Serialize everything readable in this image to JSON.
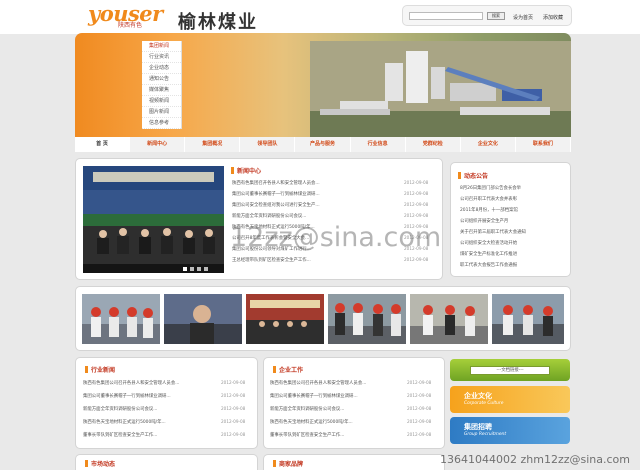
{
  "header": {
    "logo_word": "youser",
    "logo_sub": "陕西有色",
    "brand_title": "榆林煤业",
    "search_button": "搜索",
    "link_home": "设为首页",
    "link_favorite": "添加收藏"
  },
  "banner": {
    "sub_nav": [
      "集团新闻",
      "行业资讯",
      "企业动态",
      "通知公告",
      "媒体聚焦",
      "视频新闻",
      "图片新闻",
      "信息参考"
    ]
  },
  "nav": {
    "items": [
      "首 页",
      "新闻中心",
      "集团概况",
      "领导团队",
      "产品与服务",
      "行业信息",
      "党群纪检",
      "企业文化",
      "联系我们"
    ]
  },
  "news_center": {
    "title": "新闻中心",
    "rows": [
      {
        "text": "陕西有色集团召开各县人和安全管理人员会...",
        "date": "2012-09-08"
      },
      {
        "text": "集团公司董事长赛帽子一行到榆林煤业调研...",
        "date": "2012-09-08"
      },
      {
        "text": "集团公司安全检查组对我公司进行安全生产...",
        "date": "2012-09-08"
      },
      {
        "text": "新能方面全年资料调研股份公司会议...",
        "date": "2012-09-08"
      },
      {
        "text": "陕西有色天宝地材料正式运行5000吨/年...",
        "date": "2012-09-08"
      },
      {
        "text": "公司召开8年度工作表彰会暨安全大会...",
        "date": "2012-09-08"
      },
      {
        "text": "集团公司股份公司领导对煤矿工作进行...",
        "date": "2012-09-08"
      },
      {
        "text": "王总经理带队到矿区检查安全生产工作...",
        "date": "2012-09-08"
      }
    ]
  },
  "right_news": {
    "title": "动态公告",
    "rows": [
      "8月26日集团门部公告会长会举",
      "公司召开职工代表大会并表彰",
      "2011年8月份，十一部档案馆",
      "公司组织开展安全生产月",
      "关于召开第三届职工代表大会通知",
      "公司组织安全大检查活动开始",
      "煤矿安全生产标准化工作推进",
      "职工代表大会报告工作会通报"
    ]
  },
  "industry_news": {
    "title": "行业新闻",
    "rows": [
      {
        "text": "陕西有色集团公司召开各县人和安全管理人员会...",
        "date": "2012-09-08"
      },
      {
        "text": "集团公司董事长赛帽子一行到榆林煤业调研...",
        "date": "2012-09-08"
      },
      {
        "text": "新能方面全年资料调研股份公司会议...",
        "date": "2012-09-08"
      },
      {
        "text": "陕西有色天宝地材料正式运行5000吨/年...",
        "date": "2012-09-08"
      },
      {
        "text": "董事长带队到矿区检查安全生产工作...",
        "date": "2012-09-08"
      }
    ]
  },
  "company_news": {
    "title": "企业工作",
    "rows": [
      {
        "text": "陕西有色集团公司召开各县人和安全管理人员会...",
        "date": "2012-09-08"
      },
      {
        "text": "集团公司董事长赛帽子一行到榆林煤业调研...",
        "date": "2012-09-08"
      },
      {
        "text": "新能方面全年资料调研股份公司会议...",
        "date": "2012-09-08"
      },
      {
        "text": "陕西有色天宝地材料正式运行5000吨/年...",
        "date": "2012-09-08"
      },
      {
        "text": "董事长带队到矿区检查安全生产工作...",
        "date": "2012-09-08"
      }
    ]
  },
  "side_links": {
    "select_label": "---文档链接---",
    "culture_title": "企业文化",
    "culture_sub": "Corporate Culture",
    "recruit_title": "集团招聘",
    "recruit_sub": "Group Recruitment"
  },
  "bottom_heads": [
    "市场动态",
    "商家品牌"
  ],
  "watermarks": [
    "12zz@sina.com",
    "13641044002 zhm12zz@sina.com"
  ],
  "colors": {
    "brand_orange": "#f08a1c",
    "accent_red": "#c2361f"
  }
}
